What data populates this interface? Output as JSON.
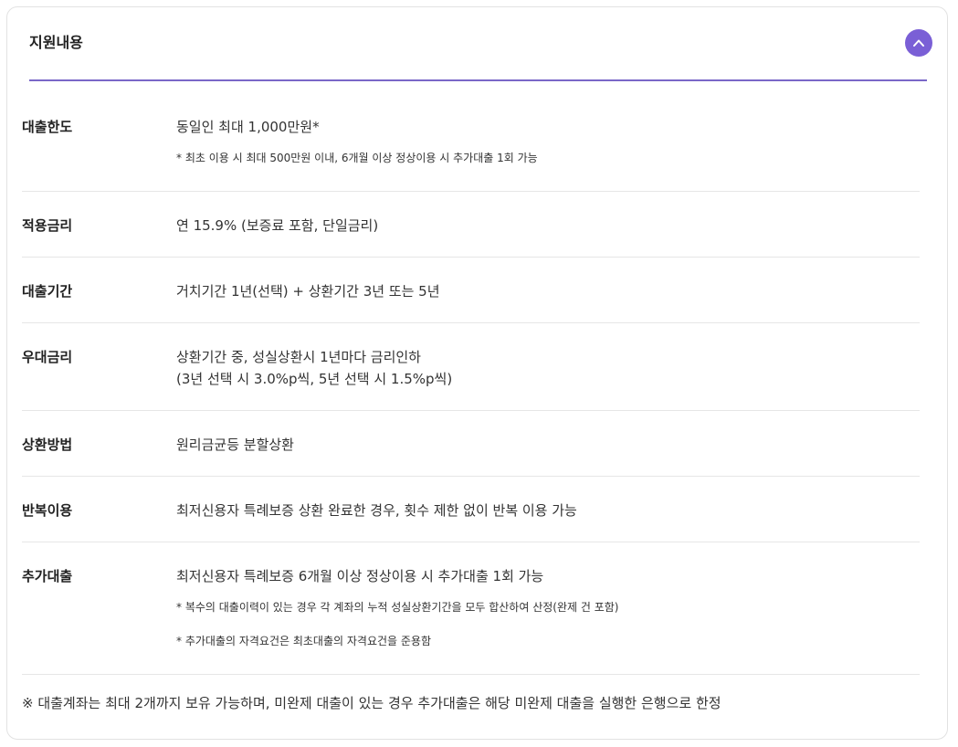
{
  "panel": {
    "title": "지원내용",
    "toggle_icon": "chevron-up-icon",
    "accent_color": "#7a5fd6"
  },
  "rows": [
    {
      "label": "대출한도",
      "text": "동일인 최대 1,000만원*",
      "notes": [
        "* 최초 이용 시 최대 500만원 이내, 6개월 이상 정상이용 시 추가대출 1회 가능"
      ]
    },
    {
      "label": "적용금리",
      "text": "연 15.9% (보증료 포함, 단일금리)"
    },
    {
      "label": "대출기간",
      "text": "거치기간 1년(선택) + 상환기간 3년 또는 5년"
    },
    {
      "label": "우대금리",
      "text": "상환기간 중, 성실상환시 1년마다 금리인하",
      "text2": "(3년 선택 시 3.0%p씩, 5년 선택 시 1.5%p씩)"
    },
    {
      "label": "상환방법",
      "text": "원리금균등 분할상환"
    },
    {
      "label": "반복이용",
      "text": "최저신용자 특례보증 상환 완료한 경우, 횟수 제한 없이 반복 이용 가능"
    },
    {
      "label": "추가대출",
      "text": "최저신용자 특례보증 6개월 이상 정상이용 시 추가대출 1회 가능",
      "notes": [
        "* 복수의 대출이력이 있는 경우 각 계좌의 누적 성실상환기간을 모두 합산하여 산정(완제 건 포함)",
        "* 추가대출의 자격요건은 최초대출의 자격요건을 준용함"
      ]
    }
  ],
  "footer_note": "※ 대출계좌는 최대 2개까지 보유 가능하며, 미완제 대출이 있는 경우 추가대출은 해당 미완제 대출을 실행한 은행으로 한정"
}
